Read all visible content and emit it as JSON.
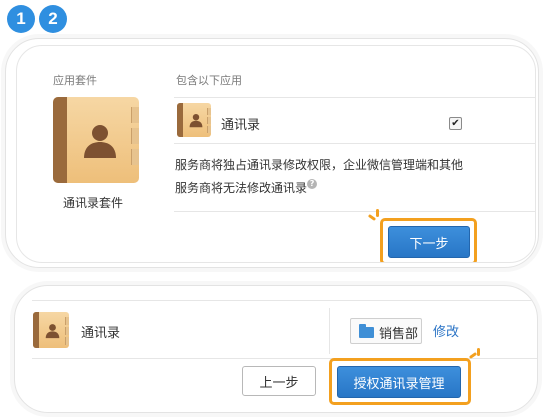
{
  "steps": [
    "1",
    "2"
  ],
  "step1": {
    "suite_column_label": "应用套件",
    "apps_column_label": "包含以下应用",
    "suite_name": "通讯录套件",
    "app_name": "通讯录",
    "app_checked": true,
    "description_line1": "服务商将独占通讯录修改权限，企业微信管理端和其他",
    "description_line2": "服务商将无法修改通讯录",
    "help_icon": "?",
    "next_button": "下一步"
  },
  "step2": {
    "app_name": "通讯录",
    "department": "销售部",
    "edit_link": "修改",
    "prev_button": "上一步",
    "authorize_button": "授权通讯录管理"
  },
  "colors": {
    "accent_blue": "#2f8fe0",
    "highlight_orange": "#f3a01f",
    "book_tan": "#eebf7a",
    "book_spine": "#9a6a3c"
  }
}
